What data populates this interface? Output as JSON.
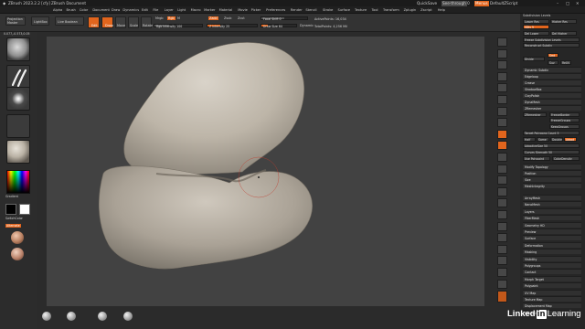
{
  "window": {
    "title": "ZBrush 2023.2.2 [cfy]  ZBrush Document",
    "quicksave": "QuickSave",
    "seethrough": "See-through  0",
    "menus_label": "Menus",
    "default_zscript": "DefaultZScript"
  },
  "menu": [
    "Alpha",
    "Brush",
    "Color",
    "Document",
    "Draw",
    "Dynamics",
    "Edit",
    "File",
    "Layer",
    "Light",
    "Macro",
    "Marker",
    "Material",
    "Movie",
    "Picker",
    "Preferences",
    "Render",
    "Stencil",
    "Stroke",
    "Surface",
    "Texture",
    "Tool",
    "Transform",
    "Zplugin",
    "Zscript",
    "Help"
  ],
  "toolbar": {
    "projection_master": "Projection Master",
    "lightbox": "LightBox",
    "live_boolean": "Live Boolean",
    "edit": "Edit",
    "draw": "Draw",
    "move": "Move",
    "scale": "Scale",
    "rotate": "Rotate",
    "mrgb": "Mrgb",
    "rgb": "Rgb",
    "m": "M",
    "zadd": "Zadd",
    "zsub": "Zsub",
    "zcut": "Zcut",
    "rgb_intensity": "Rgb Intensity 100",
    "z_intensity": "Z Intensity 25",
    "focal_shift": "Focal Shift 0",
    "draw_size": "Draw Size 64",
    "dynamic": "Dynamic",
    "active_points": "ActivePoints: 16,034",
    "total_points": "TotalPoints: 4,256 Mil",
    "coords": "0.077,-0.573,0.05"
  },
  "left_shelf": {
    "gradient": "Gradient",
    "switch_color": "SwitchColor",
    "alternate": "Alternate"
  },
  "right_panel": {
    "rows": [
      "Subdivision Levels",
      "Lower Res",
      "Higher Res",
      "SDiv 5",
      "Del Lower",
      "Del Higher",
      "Freeze Subdivision Levels",
      "Reconstruct Subdiv",
      "Smt",
      "Suv",
      "ReUV",
      "Divide"
    ],
    "divide": "Divide",
    "smt": "Smt",
    "suv": "Suv",
    "reuv": "ReUV",
    "subpalettes": [
      "Dynamic Subdiv",
      "Edgeloop",
      "Crease",
      "ShadowBox",
      "ClayPolish",
      "DynaMesh",
      "ZRemesher",
      "Modify Topology",
      "Position",
      "Size",
      "MeshIntegrity"
    ],
    "zremesher": {
      "zremesher_btn": "ZRemesher",
      "freeze_borders": "FreezeBorder",
      "freeze_groups": "FreezeGroups",
      "keep_groups": "KeepGroups",
      "target_polygons": "Target Polygons Count 5",
      "half": "Half",
      "same": "Same",
      "double": "Double",
      "adapt": "Adapt",
      "adaptive_size": "AdaptiveSize 50",
      "curves_strength": "Curves Strength 50",
      "use_polypaint": "Use Polypaint",
      "color_density": "ColorDensity"
    },
    "tool_items": [
      "ArrayMesh",
      "NanoMesh",
      "Layers",
      "FiberMesh",
      "Geometry HD",
      "Preview",
      "Surface",
      "Deformation",
      "Masking",
      "Visibility",
      "Polygroups",
      "Contact",
      "Morph Target",
      "Polypaint",
      "UV Map",
      "Texture Map",
      "Displacement Map",
      "Normal Map"
    ]
  },
  "watermark": {
    "linked": "Linked",
    "in": "in",
    "learning": "Learning"
  },
  "colors": {
    "accent": "#e2651d",
    "canvas": "#424242",
    "panel": "#262626",
    "mesh": "#c7bfb3"
  }
}
